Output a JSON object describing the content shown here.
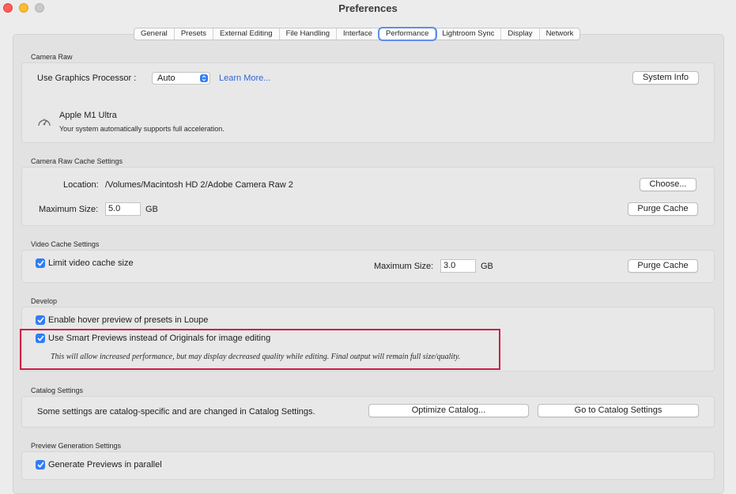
{
  "window": {
    "title": "Preferences"
  },
  "tabs": [
    {
      "label": "General"
    },
    {
      "label": "Presets"
    },
    {
      "label": "External Editing"
    },
    {
      "label": "File Handling"
    },
    {
      "label": "Interface"
    },
    {
      "label": "Performance",
      "active": true
    },
    {
      "label": "Lightroom Sync"
    },
    {
      "label": "Display"
    },
    {
      "label": "Network"
    }
  ],
  "camera_raw": {
    "section_label": "Camera Raw",
    "gpu_label": "Use Graphics Processor :",
    "gpu_value": "Auto",
    "learn_more": "Learn More...",
    "system_info_button": "System Info",
    "gpu_name": "Apple M1 Ultra",
    "gpu_status": "Your system automatically supports full acceleration."
  },
  "camera_raw_cache": {
    "section_label": "Camera Raw Cache Settings",
    "location_label": "Location:",
    "location_value": "/Volumes/Macintosh HD 2/Adobe Camera Raw 2",
    "choose_button": "Choose...",
    "max_size_label": "Maximum Size:",
    "max_size_value": "5.0",
    "unit": "GB",
    "purge_button": "Purge Cache"
  },
  "video_cache": {
    "section_label": "Video Cache Settings",
    "limit_label": "Limit video cache size",
    "limit_checked": true,
    "max_size_label": "Maximum Size:",
    "max_size_value": "3.0",
    "unit": "GB",
    "purge_button": "Purge Cache"
  },
  "develop": {
    "section_label": "Develop",
    "hover_preview_label": "Enable hover preview of presets in Loupe",
    "hover_preview_checked": true,
    "smart_previews_label": "Use Smart Previews instead of Originals for image editing",
    "smart_previews_checked": true,
    "smart_previews_note": "This will allow increased performance, but may display decreased quality while editing. Final output will remain full size/quality."
  },
  "catalog": {
    "section_label": "Catalog Settings",
    "note": "Some settings are catalog-specific and are changed in Catalog Settings.",
    "optimize_button": "Optimize Catalog...",
    "goto_button": "Go to Catalog Settings"
  },
  "preview_generation": {
    "section_label": "Preview Generation Settings",
    "parallel_label": "Generate Previews in parallel",
    "parallel_checked": true
  },
  "colors": {
    "accent": "#2f7df6",
    "highlight_border": "#d11a45",
    "link": "#2f66d6"
  }
}
